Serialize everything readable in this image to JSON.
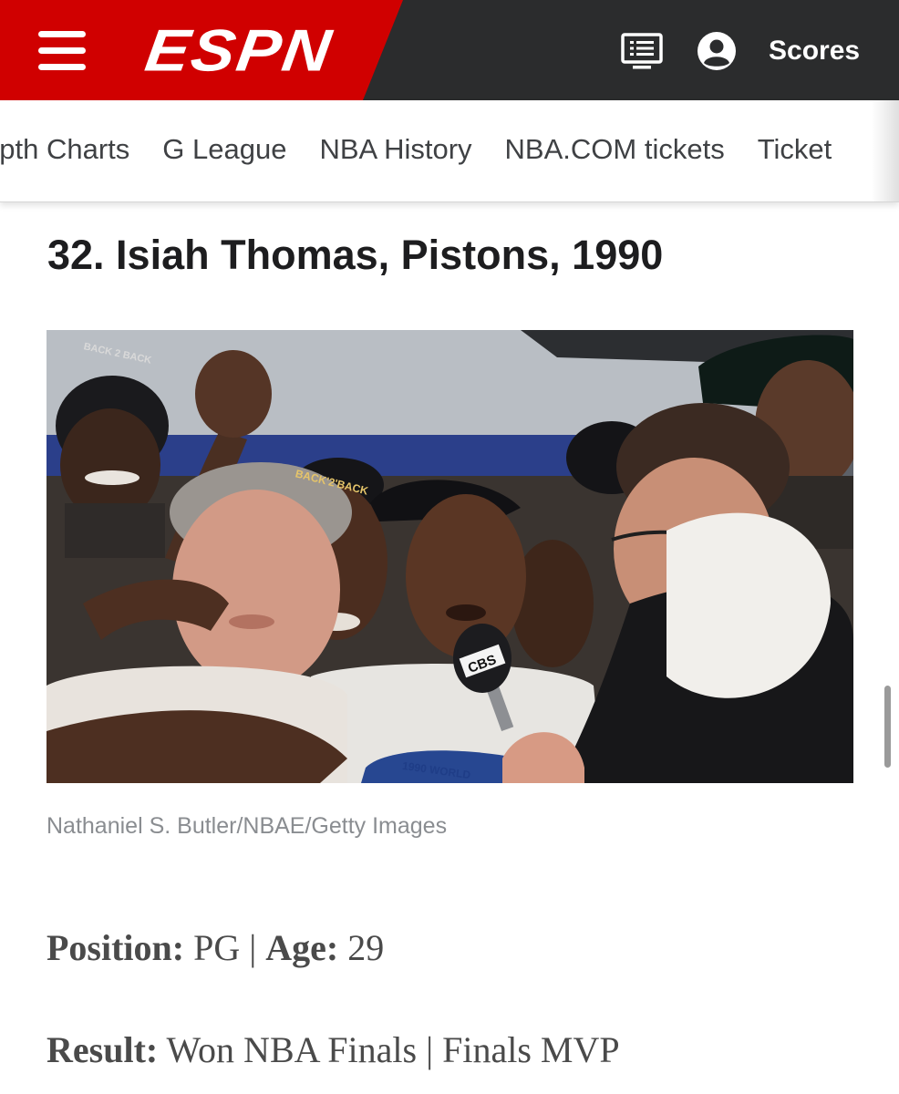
{
  "header": {
    "logo_text": "ESPN",
    "scores_label": "Scores",
    "brand_red": "#d00000",
    "bar_color": "#2b2c2d",
    "menu_icon": "hamburger-icon",
    "watch_icon": "tv-guide-icon",
    "account_icon": "account-icon"
  },
  "subnav": {
    "items": [
      {
        "label": "epth Charts"
      },
      {
        "label": "G League"
      },
      {
        "label": "NBA History"
      },
      {
        "label": "NBA.COM tickets"
      },
      {
        "label": "Ticket"
      }
    ]
  },
  "article": {
    "headline": "32. Isiah Thomas, Pistons, 1990",
    "photo": {
      "cap_text_1": "BACK 2 BACK",
      "cap_text_2": "BACK'2'BACK",
      "mic_text": "CBS",
      "shirt_text": "1990 WORLD"
    },
    "caption": "Nathaniel S. Butler/NBAE/Getty Images",
    "facts": {
      "position_label": "Position:",
      "position_value": "PG",
      "separator": "|",
      "age_label": "Age:",
      "age_value": "29",
      "result_label": "Result:",
      "result_value_1": "Won NBA Finals",
      "result_value_2": "Finals MVP"
    }
  }
}
